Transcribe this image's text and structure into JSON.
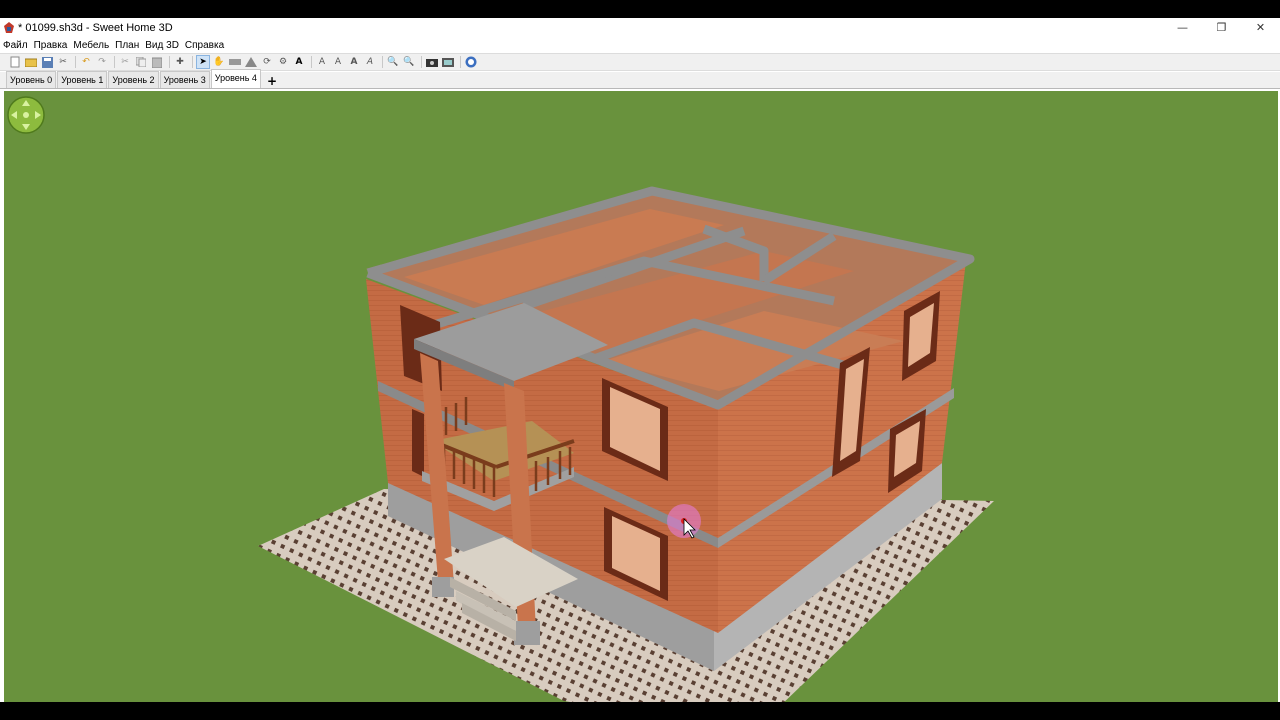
{
  "window": {
    "title": "* 01099.sh3d - Sweet Home 3D",
    "minimize_icon": "minimize-icon",
    "maximize_icon": "restore-icon",
    "close_icon": "close-icon"
  },
  "menu": {
    "items": [
      "Файл",
      "Правка",
      "Мебель",
      "План",
      "Вид 3D",
      "Справка"
    ]
  },
  "toolbar": {
    "icons": [
      "new-file-icon",
      "open-file-icon",
      "save-icon",
      "cut-tool-icon",
      "undo-icon",
      "redo-icon",
      "cut-icon",
      "copy-icon",
      "paste-icon",
      "add-furniture-icon",
      "select-icon",
      "pan-icon",
      "create-walls-icon",
      "create-rooms-icon",
      "create-polylines-icon",
      "create-dimensions-icon",
      "add-text-icon",
      "zoom-in-icon",
      "zoom-out-icon",
      "create-photo-icon",
      "create-video-icon",
      "help-icon"
    ]
  },
  "levels": {
    "tabs": [
      "Уровень 0",
      "Уровень 1",
      "Уровень 2",
      "Уровень 3",
      "Уровень 4"
    ],
    "active_index": 4,
    "add_label": "+"
  },
  "colors": {
    "grass": "#69923d",
    "brick": "#c4683f",
    "wall_top": "#8e8e8e",
    "window_frame": "#6b2b17",
    "navigator": "#8dbb3e"
  }
}
